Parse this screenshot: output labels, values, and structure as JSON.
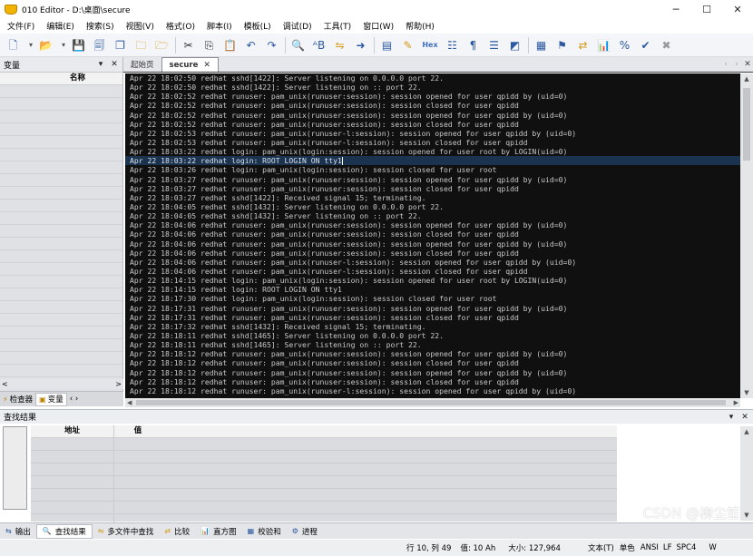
{
  "window": {
    "title": "010 Editor - D:\\桌面\\secure",
    "minimize": "─",
    "maximize": "☐",
    "close": "✕"
  },
  "menu": [
    "文件(F)",
    "编辑(E)",
    "搜索(S)",
    "视图(V)",
    "格式(O)",
    "脚本(I)",
    "模板(L)",
    "调试(D)",
    "工具(T)",
    "窗口(W)",
    "帮助(H)"
  ],
  "toolbar": {
    "hex_label": "Hex",
    "icons": [
      "new-file-icon",
      "open-folder-icon",
      "save-icon",
      "save-all-icon",
      "copy-pages-icon",
      "folder-icon",
      "folders-icon",
      "cut-icon",
      "copy-icon",
      "paste-icon",
      "undo-icon",
      "redo-icon",
      "find-icon",
      "replace-icon",
      "find-in-files-icon",
      "goto-icon",
      "template-icon",
      "script-icon",
      "hex-icon",
      "columns-icon",
      "paragraph-icon",
      "wrap-icon",
      "highlight-icon",
      "calculator-icon",
      "bookmark-icon",
      "compare-icon",
      "histogram-icon",
      "percent-icon",
      "checksum-icon",
      "stop-icon"
    ]
  },
  "left_panel": {
    "title": "变量",
    "column_name": "名称",
    "tabs": [
      {
        "label": "检查器",
        "icon": "lightning-icon"
      },
      {
        "label": "变量",
        "icon": "variables-icon"
      }
    ]
  },
  "editor": {
    "tabs": [
      {
        "label": "起始页",
        "active": false
      },
      {
        "label": "secure",
        "active": true
      }
    ],
    "current_line_index": 10,
    "lines": [
      "Apr 22 18:02:50 redhat sshd[1422]: Server listening on 0.0.0.0 port 22.",
      "Apr 22 18:02:50 redhat sshd[1422]: Server listening on :: port 22.",
      "Apr 22 18:02:52 redhat runuser: pam_unix(runuser:session): session opened for user qpidd by (uid=0)",
      "Apr 22 18:02:52 redhat runuser: pam_unix(runuser:session): session closed for user qpidd",
      "Apr 22 18:02:52 redhat runuser: pam_unix(runuser:session): session opened for user qpidd by (uid=0)",
      "Apr 22 18:02:52 redhat runuser: pam_unix(runuser:session): session closed for user qpidd",
      "Apr 22 18:02:53 redhat runuser: pam_unix(runuser-l:session): session opened for user qpidd by (uid=0)",
      "Apr 22 18:02:53 redhat runuser: pam_unix(runuser-l:session): session closed for user qpidd",
      "Apr 22 18:03:22 redhat login: pam_unix(login:session): session opened for user root by LOGIN(uid=0)",
      "Apr 22 18:03:22 redhat login: ROOT LOGIN ON tty1",
      "Apr 22 18:03:26 redhat login: pam_unix(login:session): session closed for user root",
      "Apr 22 18:03:27 redhat runuser: pam_unix(runuser:session): session opened for user qpidd by (uid=0)",
      "Apr 22 18:03:27 redhat runuser: pam_unix(runuser:session): session closed for user qpidd",
      "Apr 22 18:03:27 redhat sshd[1422]: Received signal 15; terminating.",
      "Apr 22 18:04:05 redhat sshd[1432]: Server listening on 0.0.0.0 port 22.",
      "Apr 22 18:04:05 redhat sshd[1432]: Server listening on :: port 22.",
      "Apr 22 18:04:06 redhat runuser: pam_unix(runuser:session): session opened for user qpidd by (uid=0)",
      "Apr 22 18:04:06 redhat runuser: pam_unix(runuser:session): session closed for user qpidd",
      "Apr 22 18:04:06 redhat runuser: pam_unix(runuser:session): session opened for user qpidd by (uid=0)",
      "Apr 22 18:04:06 redhat runuser: pam_unix(runuser:session): session closed for user qpidd",
      "Apr 22 18:04:06 redhat runuser: pam_unix(runuser-l:session): session opened for user qpidd by (uid=0)",
      "Apr 22 18:04:06 redhat runuser: pam_unix(runuser-l:session): session closed for user qpidd",
      "Apr 22 18:14:15 redhat login: pam_unix(login:session): session opened for user root by LOGIN(uid=0)",
      "Apr 22 18:14:15 redhat login: ROOT LOGIN ON tty1",
      "Apr 22 18:17:30 redhat login: pam_unix(login:session): session closed for user root",
      "Apr 22 18:17:31 redhat runuser: pam_unix(runuser:session): session opened for user qpidd by (uid=0)",
      "Apr 22 18:17:31 redhat runuser: pam_unix(runuser:session): session closed for user qpidd",
      "Apr 22 18:17:32 redhat sshd[1432]: Received signal 15; terminating.",
      "Apr 22 18:18:11 redhat sshd[1465]: Server listening on 0.0.0.0 port 22.",
      "Apr 22 18:18:11 redhat sshd[1465]: Server listening on :: port 22.",
      "Apr 22 18:18:12 redhat runuser: pam_unix(runuser:session): session opened for user qpidd by (uid=0)",
      "Apr 22 18:18:12 redhat runuser: pam_unix(runuser:session): session closed for user qpidd",
      "Apr 22 18:18:12 redhat runuser: pam_unix(runuser:session): session opened for user qpidd by (uid=0)",
      "Apr 22 18:18:12 redhat runuser: pam_unix(runuser:session): session closed for user qpidd",
      "Apr 22 18:18:12 redhat runuser: pam_unix(runuser-l:session): session opened for user qpidd by (uid=0)"
    ]
  },
  "find_panel": {
    "title": "查找结果",
    "col_address": "地址",
    "col_value": "值"
  },
  "bottom_tabs": [
    {
      "label": "输出",
      "icon": "output-icon",
      "active": false
    },
    {
      "label": "查找结果",
      "icon": "find-results-icon",
      "active": true
    },
    {
      "label": "多文件中查找",
      "icon": "find-in-files-icon",
      "active": false
    },
    {
      "label": "比较",
      "icon": "compare-icon",
      "active": false
    },
    {
      "label": "直方图",
      "icon": "histogram-icon",
      "active": false
    },
    {
      "label": "校验和",
      "icon": "checksum-icon",
      "active": false
    },
    {
      "label": "进程",
      "icon": "process-icon",
      "active": false
    }
  ],
  "status": {
    "position": "行 10, 列 49",
    "value": "值: 10 Ah",
    "size": "大小: 127,964",
    "encoding": "文本(T)",
    "unit": "单色",
    "ansi": "ANSI",
    "lf": "LF",
    "spc": "SPC4",
    "w": "W"
  },
  "watermark": "CSDN @柳尘笙"
}
